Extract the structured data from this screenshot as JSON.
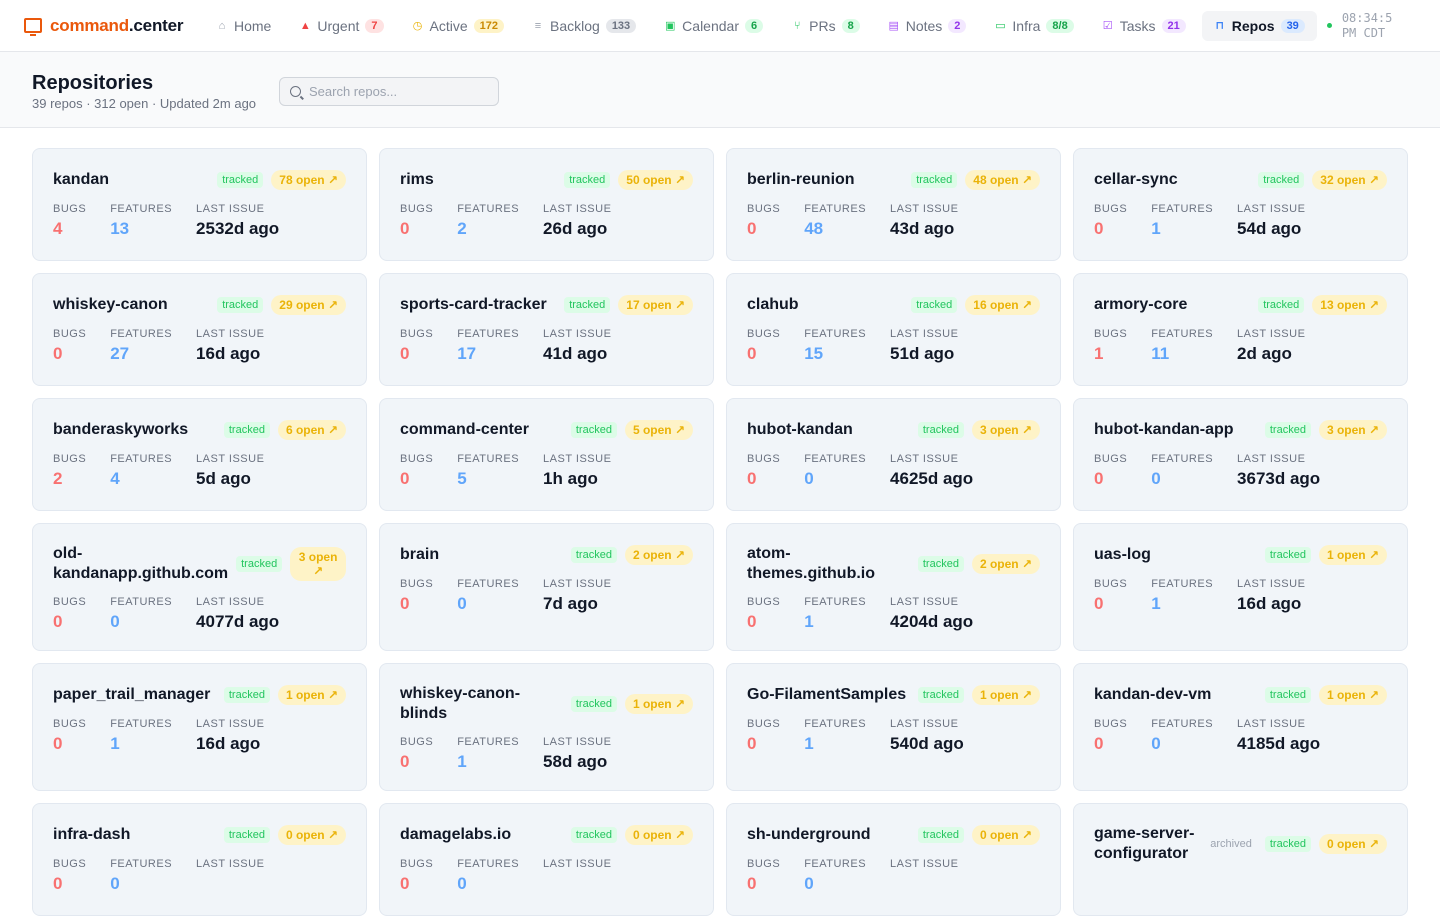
{
  "brand": {
    "name_accent": "command",
    "name_rest": ".center"
  },
  "nav": [
    {
      "label": "Home",
      "icon": "⌂",
      "icon_name": "home-icon",
      "icon_color": "#9ca3af",
      "badge": null
    },
    {
      "label": "Urgent",
      "icon": "▲",
      "icon_name": "warning-icon",
      "icon_color": "#ef4444",
      "badge": "7",
      "badge_bg": "#fee2e2",
      "badge_fg": "#ef4444"
    },
    {
      "label": "Active",
      "icon": "◷",
      "icon_name": "clock-icon",
      "icon_color": "#eab308",
      "badge": "172",
      "badge_bg": "#fef3c7",
      "badge_fg": "#ca8a04"
    },
    {
      "label": "Backlog",
      "icon": "≡",
      "icon_name": "list-icon",
      "icon_color": "#9ca3af",
      "badge": "133",
      "badge_bg": "#e5e7eb",
      "badge_fg": "#6b7280"
    },
    {
      "label": "Calendar",
      "icon": "▣",
      "icon_name": "calendar-icon",
      "icon_color": "#22c55e",
      "badge": "6",
      "badge_bg": "#dcfce7",
      "badge_fg": "#16a34a"
    },
    {
      "label": "PRs",
      "icon": "⑂",
      "icon_name": "git-pull-request-icon",
      "icon_color": "#22c55e",
      "badge": "8",
      "badge_bg": "#dcfce7",
      "badge_fg": "#16a34a"
    },
    {
      "label": "Notes",
      "icon": "▤",
      "icon_name": "note-icon",
      "icon_color": "#a855f7",
      "badge": "2",
      "badge_bg": "#f3e8ff",
      "badge_fg": "#9333ea"
    },
    {
      "label": "Infra",
      "icon": "▭",
      "icon_name": "monitor-icon",
      "icon_color": "#22c55e",
      "badge": "8/8",
      "badge_bg": "#dcfce7",
      "badge_fg": "#16a34a"
    },
    {
      "label": "Tasks",
      "icon": "☑",
      "icon_name": "checkbox-icon",
      "icon_color": "#a855f7",
      "badge": "21",
      "badge_bg": "#f3e8ff",
      "badge_fg": "#9333ea"
    },
    {
      "label": "Repos",
      "icon": "⊓",
      "icon_name": "repo-icon",
      "icon_color": "#3b82f6",
      "badge": "39",
      "badge_bg": "#dbeafe",
      "badge_fg": "#2563eb",
      "active": true
    }
  ],
  "clock": {
    "time": "08:34:5",
    "zone": "PM CDT"
  },
  "header": {
    "title": "Repositories",
    "subtitle": "39 repos · 312 open · Updated 2m ago",
    "search_placeholder": "Search repos..."
  },
  "labels": {
    "bugs": "BUGS",
    "features": "FEATURES",
    "last_issue": "LAST ISSUE",
    "tracked": "tracked",
    "archived": "archived"
  },
  "repos": [
    {
      "name": "kandan",
      "open": "78 open ↗",
      "bugs": "4",
      "features": "13",
      "last": "2532d ago"
    },
    {
      "name": "rims",
      "open": "50 open ↗",
      "bugs": "0",
      "features": "2",
      "last": "26d ago"
    },
    {
      "name": "berlin-reunion",
      "open": "48 open ↗",
      "bugs": "0",
      "features": "48",
      "last": "43d ago"
    },
    {
      "name": "cellar-sync",
      "open": "32 open ↗",
      "bugs": "0",
      "features": "1",
      "last": "54d ago"
    },
    {
      "name": "whiskey-canon",
      "open": "29 open ↗",
      "bugs": "0",
      "features": "27",
      "last": "16d ago"
    },
    {
      "name": "sports-card-tracker",
      "open": "17 open ↗",
      "bugs": "0",
      "features": "17",
      "last": "41d ago"
    },
    {
      "name": "clahub",
      "open": "16 open ↗",
      "bugs": "0",
      "features": "15",
      "last": "51d ago"
    },
    {
      "name": "armory-core",
      "open": "13 open ↗",
      "bugs": "1",
      "features": "11",
      "last": "2d ago"
    },
    {
      "name": "banderaskyworks",
      "open": "6 open ↗",
      "bugs": "2",
      "features": "4",
      "last": "5d ago"
    },
    {
      "name": "command-center",
      "open": "5 open ↗",
      "bugs": "0",
      "features": "5",
      "last": "1h ago"
    },
    {
      "name": "hubot-kandan",
      "open": "3 open ↗",
      "bugs": "0",
      "features": "0",
      "last": "4625d ago"
    },
    {
      "name": "hubot-kandan-app",
      "open": "3 open ↗",
      "bugs": "0",
      "features": "0",
      "last": "3673d ago"
    },
    {
      "name": "old-kandanapp.github.com",
      "open": "3 open ↗",
      "bugs": "0",
      "features": "0",
      "last": "4077d ago"
    },
    {
      "name": "brain",
      "open": "2 open ↗",
      "bugs": "0",
      "features": "0",
      "last": "7d ago"
    },
    {
      "name": "atom-themes.github.io",
      "open": "2 open ↗",
      "bugs": "0",
      "features": "1",
      "last": "4204d ago"
    },
    {
      "name": "uas-log",
      "open": "1 open ↗",
      "bugs": "0",
      "features": "1",
      "last": "16d ago"
    },
    {
      "name": "paper_trail_manager",
      "open": "1 open ↗",
      "bugs": "0",
      "features": "1",
      "last": "16d ago"
    },
    {
      "name": "whiskey-canon-blinds",
      "open": "1 open ↗",
      "bugs": "0",
      "features": "1",
      "last": "58d ago"
    },
    {
      "name": "Go-FilamentSamples",
      "open": "1 open ↗",
      "bugs": "0",
      "features": "1",
      "last": "540d ago"
    },
    {
      "name": "kandan-dev-vm",
      "open": "1 open ↗",
      "bugs": "0",
      "features": "0",
      "last": "4185d ago"
    },
    {
      "name": "infra-dash",
      "open": "0 open ↗",
      "bugs": "0",
      "features": "0",
      "last": ""
    },
    {
      "name": "damagelabs.io",
      "open": "0 open ↗",
      "bugs": "0",
      "features": "0",
      "last": ""
    },
    {
      "name": "sh-underground",
      "open": "0 open ↗",
      "bugs": "0",
      "features": "0",
      "last": ""
    },
    {
      "name": "game-server-configurator",
      "open": "0 open ↗",
      "bugs": "",
      "features": "",
      "last": "",
      "archived": true
    }
  ]
}
